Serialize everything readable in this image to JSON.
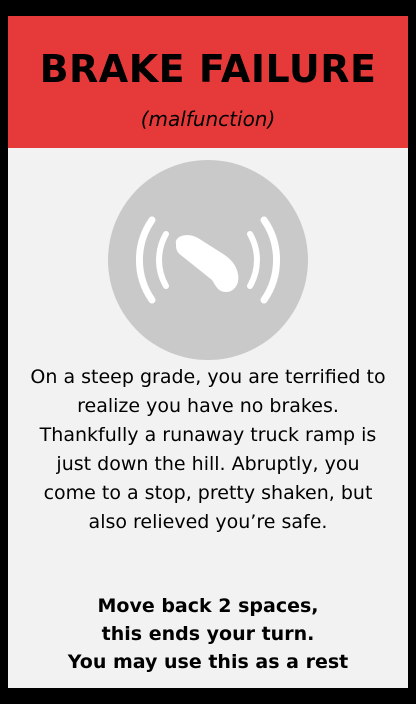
{
  "card": {
    "title": "BRAKE FAILURE",
    "subtitle": "(malfunction)",
    "icon": "brake-warning-icon",
    "story": "On a steep grade, you are terrified to realize you have no brakes. Thankfully a runaway truck ramp is just down the hill. Abruptly, you come to a stop, pretty shaken, but also relieved you’re safe.",
    "instructions": [
      "Move back 2 spaces,",
      "this ends your turn.",
      "You may use this as a rest"
    ]
  },
  "colors": {
    "header": "#e63a3a",
    "card_background": "#f2f2f2",
    "icon_circle": "#c9c9c9",
    "icon": "#ffffff",
    "page_background": "#000000"
  }
}
